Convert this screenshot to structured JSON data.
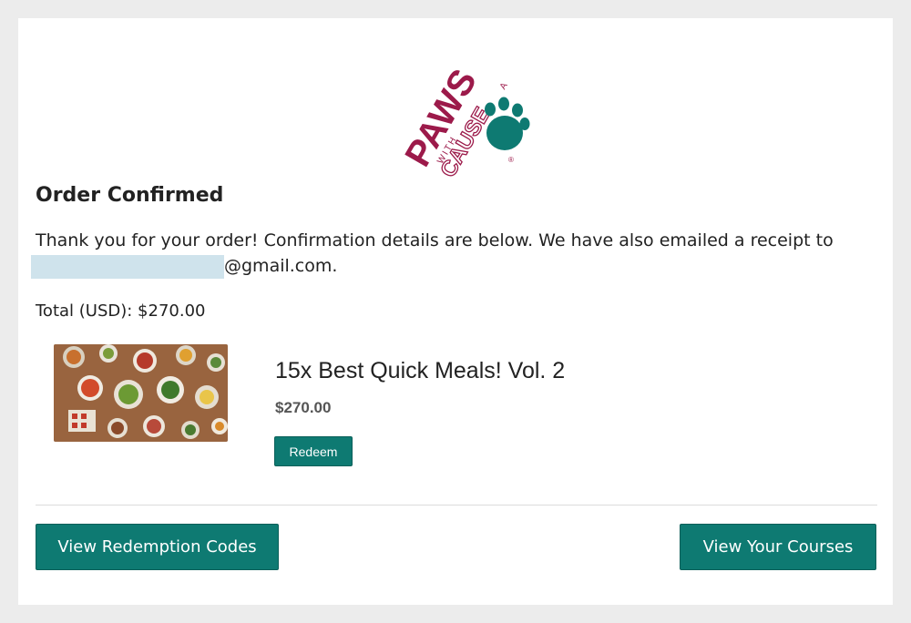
{
  "brand": {
    "logo_primary": "PAWS",
    "logo_with": "WITH",
    "logo_a": "A",
    "logo_cause": "CAUSE",
    "logo_mark": "®",
    "maroon": "#9c1a4a",
    "teal": "#0e7a72"
  },
  "order": {
    "title": "Order Confirmed",
    "thanks_text": "Thank you for your order! Confirmation details are below. We have also emailed a receipt to",
    "email_suffix": "@gmail.com.",
    "total_text": "Total (USD): $270.00"
  },
  "item": {
    "name": "15x Best Quick Meals! Vol. 2",
    "price": "$270.00",
    "redeem_label": "Redeem",
    "image_icon": "food-spread-photo"
  },
  "actions": {
    "view_codes_label": "View Redemption Codes",
    "view_courses_label": "View Your Courses",
    "button_color": "#0e7a72"
  }
}
